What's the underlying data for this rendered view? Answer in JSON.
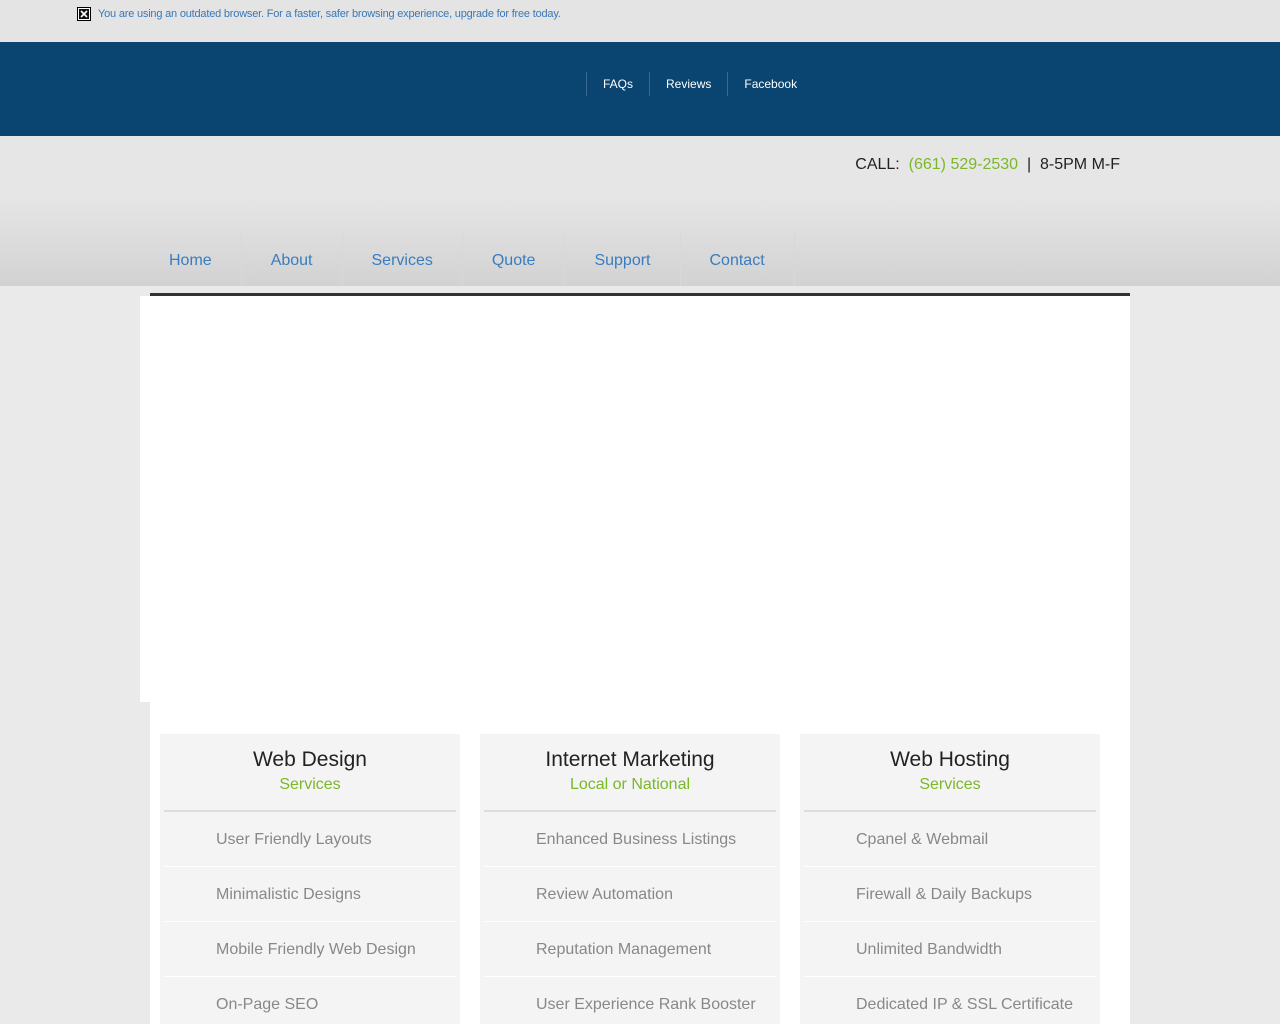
{
  "notice": {
    "text": "You are using an outdated browser. For a faster, safer browsing experience, upgrade for free today."
  },
  "topnav": {
    "items": [
      "FAQs",
      "Reviews",
      "Facebook"
    ]
  },
  "header": {
    "call_label": "CALL:",
    "phone": "(661) 529-2530",
    "separator": "|",
    "hours": "8-5PM M-F"
  },
  "mainnav": {
    "items": [
      "Home",
      "About",
      "Services",
      "Quote",
      "Support",
      "Contact"
    ]
  },
  "columns": [
    {
      "title": "Web Design",
      "subtitle": "Services",
      "items": [
        "User Friendly Layouts",
        "Minimalistic Designs",
        "Mobile Friendly Web Design",
        "On-Page SEO"
      ]
    },
    {
      "title": "Internet Marketing",
      "subtitle": "Local or National",
      "items": [
        "Enhanced Business Listings",
        "Review Automation",
        "Reputation Management",
        "User Experience Rank Booster"
      ]
    },
    {
      "title": "Web Hosting",
      "subtitle": "Services",
      "items": [
        "Cpanel & Webmail",
        "Firewall & Daily Backups",
        "Unlimited Bandwidth",
        "Dedicated IP & SSL Certificate"
      ]
    }
  ],
  "colors": {
    "topbar": "#0a4470",
    "nav_link": "#3a7cc0",
    "accent_green": "#7ab828"
  }
}
